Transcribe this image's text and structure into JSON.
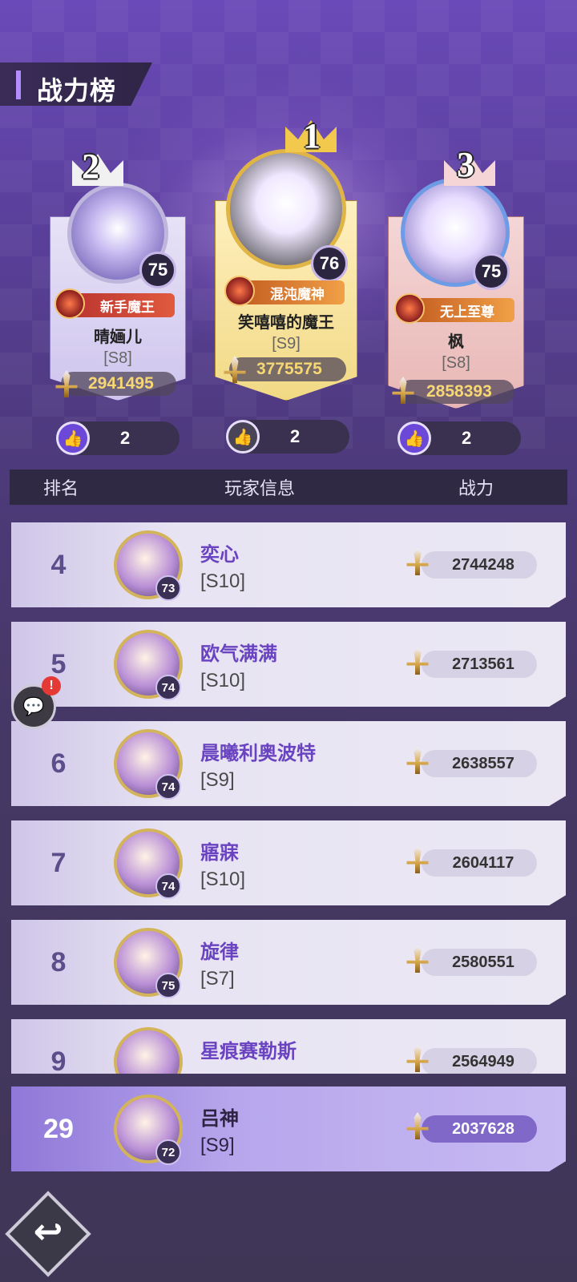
{
  "page_title": "战力榜",
  "podium": [
    {
      "rank": "2",
      "level": "75",
      "title": "新手魔王",
      "name": "晴婳儿",
      "server": "[S8]",
      "power": "2941495",
      "likes": "2"
    },
    {
      "rank": "1",
      "level": "76",
      "title": "混沌魔神",
      "name": "笑嘻嘻的魔王",
      "server": "[S9]",
      "power": "3775575",
      "likes": "2"
    },
    {
      "rank": "3",
      "level": "75",
      "title": "无上至尊",
      "name": "枫",
      "server": "[S8]",
      "power": "2858393",
      "likes": "2"
    }
  ],
  "header": {
    "rank": "排名",
    "player": "玩家信息",
    "power": "战力"
  },
  "rows": [
    {
      "rank": "4",
      "level": "73",
      "name": "奕心",
      "server": "[S10]",
      "power": "2744248"
    },
    {
      "rank": "5",
      "level": "74",
      "name": "欧气满满",
      "server": "[S10]",
      "power": "2713561"
    },
    {
      "rank": "6",
      "level": "74",
      "name": "晨曦利奥波特",
      "server": "[S9]",
      "power": "2638557"
    },
    {
      "rank": "7",
      "level": "74",
      "name": "寤寐",
      "server": "[S10]",
      "power": "2604117"
    },
    {
      "rank": "8",
      "level": "75",
      "name": "旋律",
      "server": "[S7]",
      "power": "2580551"
    },
    {
      "rank": "9",
      "level": "",
      "name": "星痕赛勒斯",
      "server": "",
      "power": "2564949"
    }
  ],
  "my_row": {
    "rank": "29",
    "level": "72",
    "name": "吕神",
    "server": "[S9]",
    "power": "2037628"
  },
  "chat_alert": "!",
  "icons": {
    "like": "thumbs-up-icon",
    "power": "sword-icon",
    "back": "back-arrow-icon",
    "chat": "chat-icon"
  },
  "colors": {
    "accent": "#6a44c0",
    "highlight_row": "#b7a6ec",
    "power_text": "#f7d774"
  }
}
